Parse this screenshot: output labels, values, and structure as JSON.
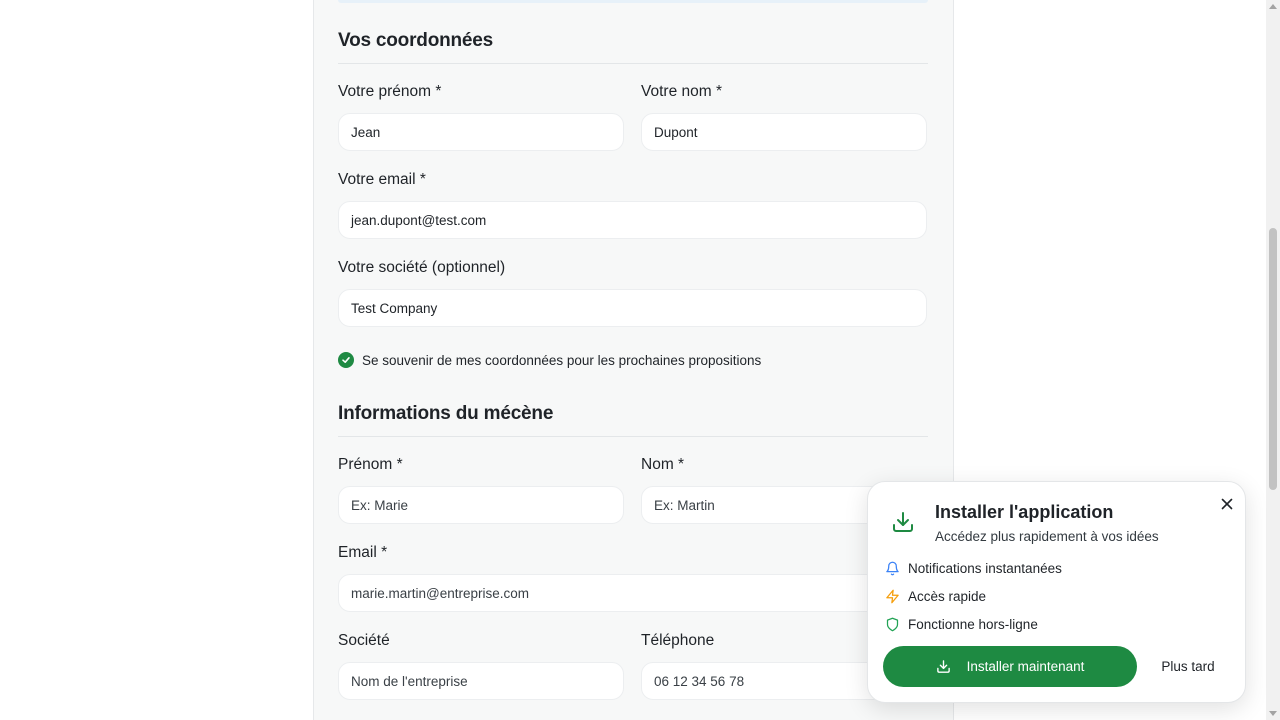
{
  "contact_section": {
    "title": "Vos coordonnées",
    "first_name": {
      "label": "Votre prénom *",
      "value": "Jean"
    },
    "last_name": {
      "label": "Votre nom *",
      "value": "Dupont"
    },
    "email": {
      "label": "Votre email *",
      "value": "jean.dupont@test.com"
    },
    "company": {
      "label": "Votre société (optionnel)",
      "value": "Test Company"
    },
    "remember": {
      "checked": true,
      "label": "Se souvenir de mes coordonnées pour les prochaines propositions"
    }
  },
  "patron_section": {
    "title": "Informations du mécène",
    "first_name": {
      "label": "Prénom *",
      "placeholder": "Ex: Marie"
    },
    "last_name": {
      "label": "Nom *",
      "placeholder": "Ex: Martin"
    },
    "email": {
      "label": "Email *",
      "placeholder": "marie.martin@entreprise.com"
    },
    "company": {
      "label": "Société",
      "placeholder": "Nom de l'entreprise"
    },
    "phone": {
      "label": "Téléphone",
      "placeholder": "06 12 34 56 78"
    }
  },
  "install_prompt": {
    "icon": "download-icon",
    "title": "Installer l'application",
    "subtitle": "Accédez plus rapidement à vos idées",
    "features": [
      {
        "icon": "bell-icon",
        "color": "#3b82f6",
        "label": "Notifications instantanées"
      },
      {
        "icon": "zap-icon",
        "color": "#f59e0b",
        "label": "Accès rapide"
      },
      {
        "icon": "shield-icon",
        "color": "#22a355",
        "label": "Fonctionne hors-ligne"
      }
    ],
    "install_label": "Installer maintenant",
    "later_label": "Plus tard"
  },
  "colors": {
    "accent_green": "#1e8a42",
    "page_background": "#f7f8f8"
  }
}
